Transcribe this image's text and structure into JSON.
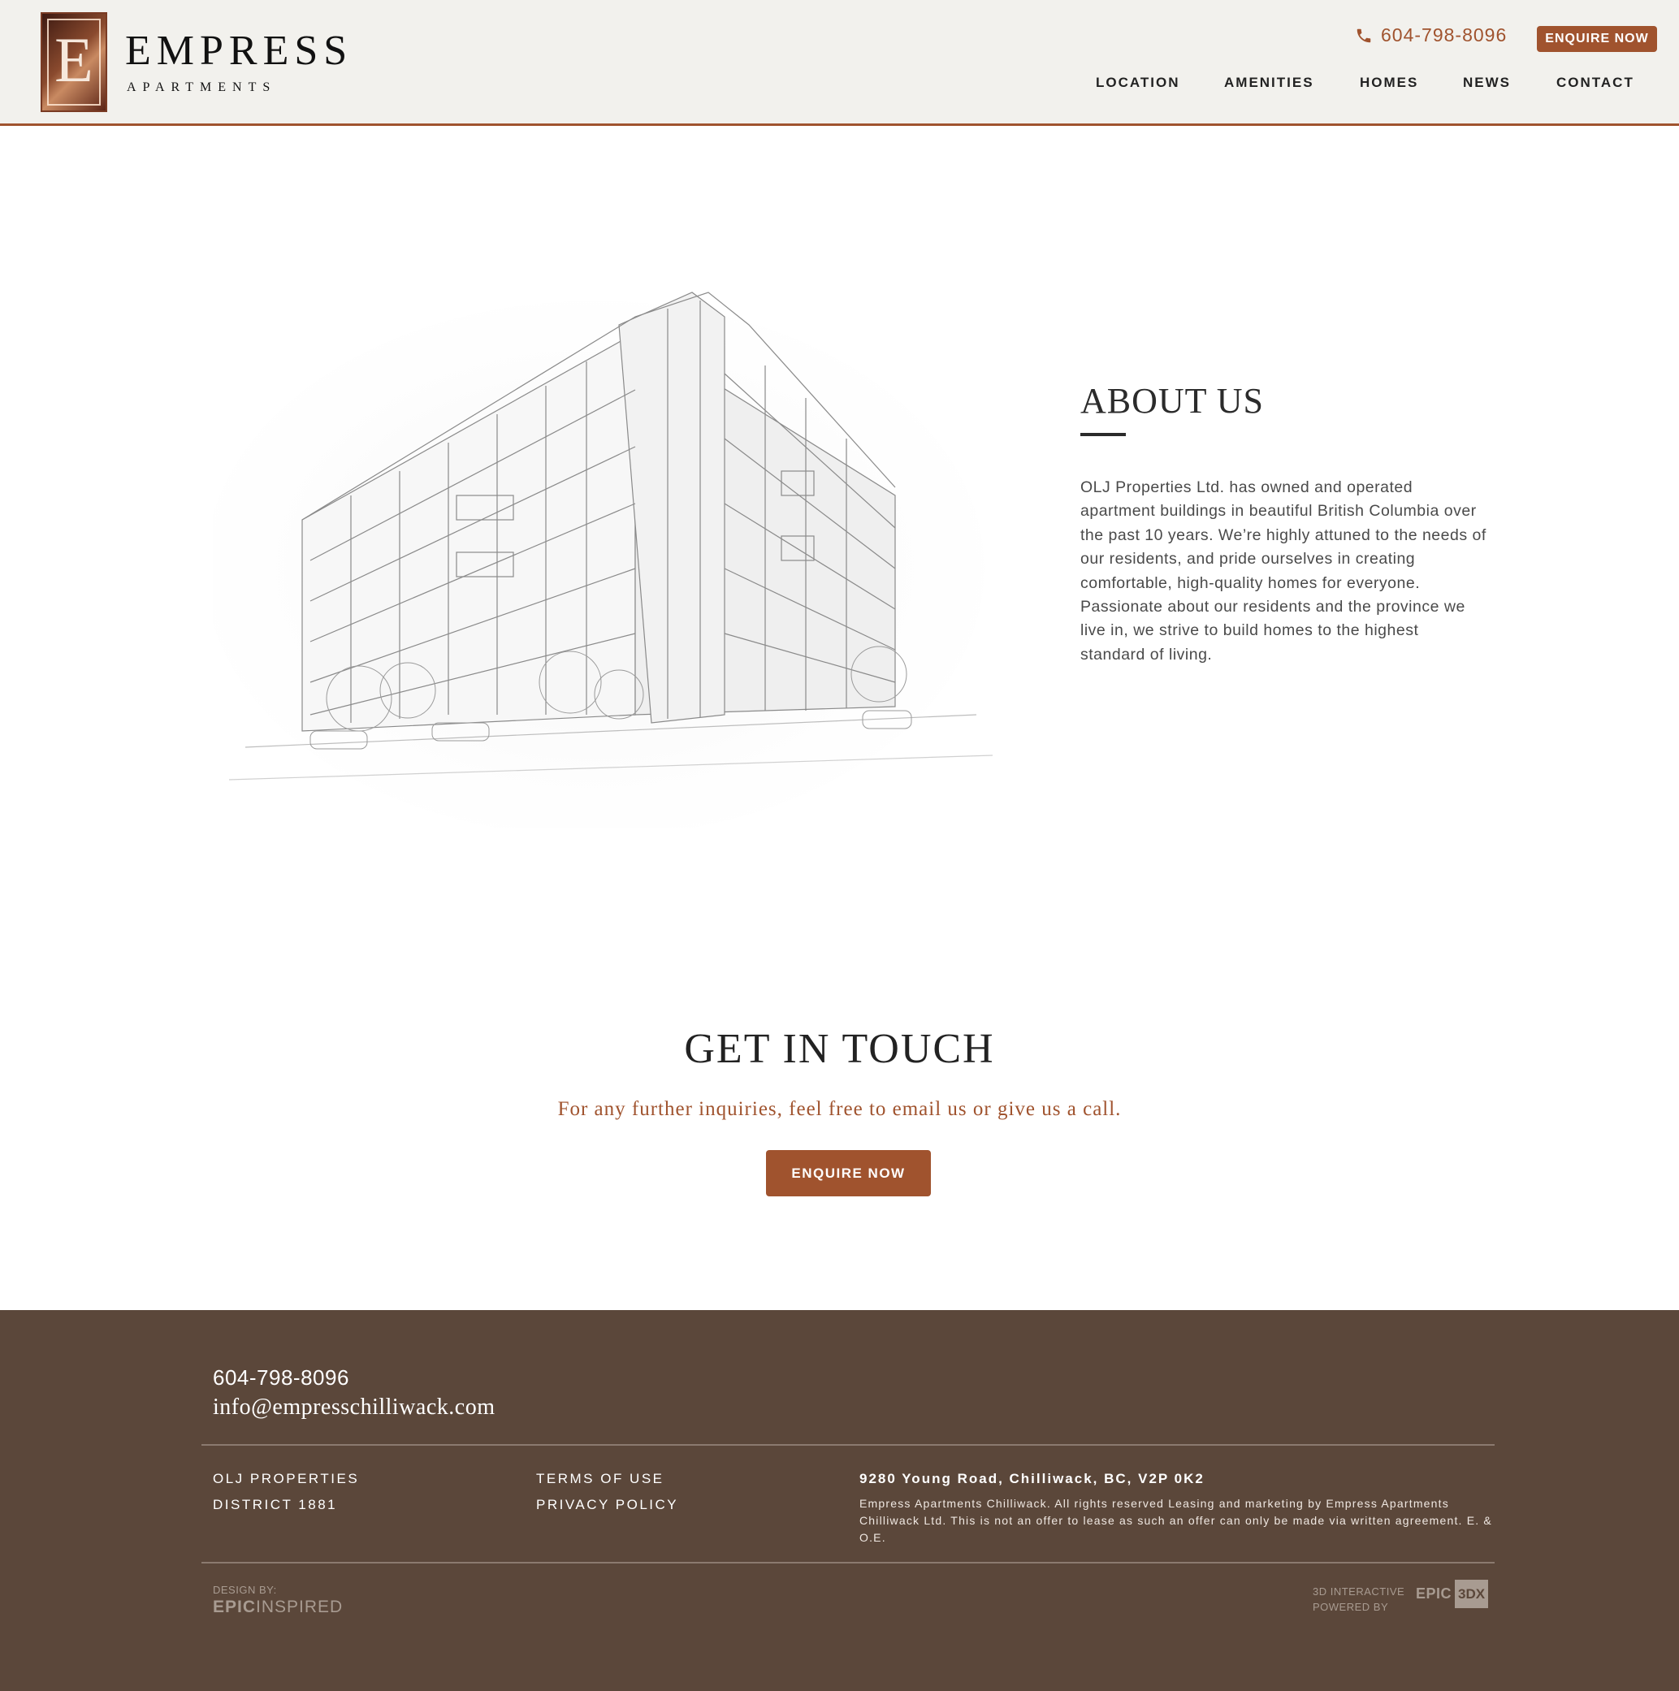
{
  "header": {
    "brand_title": "EMPRESS",
    "brand_subtitle": "APARTMENTS",
    "logo_letter": "E",
    "phone": "604-798-8096",
    "enquire_label": "ENQUIRE NOW",
    "nav": [
      "LOCATION",
      "AMENITIES",
      "HOMES",
      "NEWS",
      "CONTACT"
    ]
  },
  "about": {
    "title": "ABOUT US",
    "body": "OLJ Properties Ltd. has owned and operated apartment buildings in beautiful British Columbia over the past 10 years. We’re highly attuned to the needs of our residents, and pride ourselves in creating comfortable, high-quality homes for everyone. Passionate about our residents and the province we live in, we strive to build homes to the highest standard of living."
  },
  "contact": {
    "title": "GET IN TOUCH",
    "subtitle": "For any further inquiries, feel free to email us or give us a call.",
    "button_label": "ENQUIRE NOW"
  },
  "footer": {
    "phone": "604-798-8096",
    "email": "info@empresschilliwack.com",
    "links_col1": [
      "OLJ PROPERTIES",
      "DISTRICT 1881"
    ],
    "links_col2": [
      "TERMS OF USE",
      "PRIVACY POLICY"
    ],
    "address": "9280 Young Road, Chilliwack, BC, V2P 0K2",
    "legal": "Empress Apartments Chilliwack. All rights reserved Leasing and marketing by Empress Apartments Chilliwack Ltd. This is not an offer to lease as such an offer can only be made via written agreement. E. & O.E.",
    "design_label": "DESIGN BY:",
    "design_brand_bold": "EPIC",
    "design_brand_light": "INSPIRED",
    "interactive_line1": "3D INTERACTIVE",
    "interactive_line2": "POWERED BY",
    "interactive_brand1": "EPIC",
    "interactive_brand2": "3DX"
  },
  "colors": {
    "accent": "#a0532e",
    "header_bg": "#f2f1ed",
    "footer_bg": "#5b473a"
  }
}
